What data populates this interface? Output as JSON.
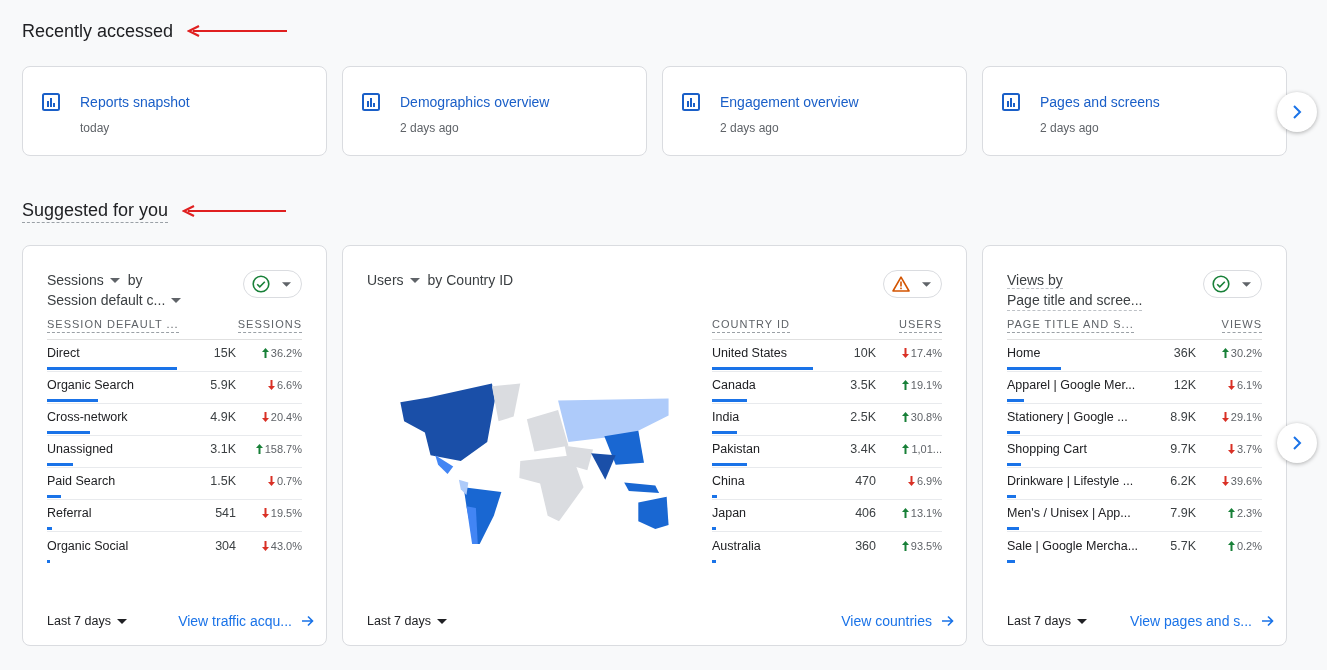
{
  "recently_accessed": {
    "heading": "Recently accessed",
    "items": [
      {
        "title": "Reports snapshot",
        "time": "today"
      },
      {
        "title": "Demographics overview",
        "time": "2 days ago"
      },
      {
        "title": "Engagement overview",
        "time": "2 days ago"
      },
      {
        "title": "Pages and screens",
        "time": "2 days ago"
      }
    ]
  },
  "suggested": {
    "heading": "Suggested for you",
    "cards": [
      {
        "kind": "table",
        "title": {
          "metric": "Sessions",
          "by": "by",
          "dimension": "Session default c...",
          "dropdown": true
        },
        "warning": false,
        "columns": [
          "SESSION DEFAULT ...",
          "SESSIONS"
        ],
        "rows": [
          {
            "name": "Direct",
            "value": "15K",
            "change": "36.2%",
            "rising": true,
            "level": 0.51
          },
          {
            "name": "Organic Search",
            "value": "5.9K",
            "change": "6.6%",
            "rising": false,
            "level": 0.2
          },
          {
            "name": "Cross-network",
            "value": "4.9K",
            "change": "20.4%",
            "rising": false,
            "level": 0.17
          },
          {
            "name": "Unassigned",
            "value": "3.1K",
            "change": "158.7%",
            "rising": true,
            "level": 0.1
          },
          {
            "name": "Paid Search",
            "value": "1.5K",
            "change": "0.7%",
            "rising": false,
            "level": 0.055
          },
          {
            "name": "Referral",
            "value": "541",
            "change": "19.5%",
            "rising": false,
            "level": 0.02
          },
          {
            "name": "Organic Social",
            "value": "304",
            "change": "43.0%",
            "rising": false,
            "level": 0.012
          }
        ],
        "range": "Last 7 days",
        "link": "View traffic acqu..."
      },
      {
        "kind": "map",
        "title": {
          "metric": "Users",
          "by": "by Country ID",
          "dropdown": true
        },
        "warning": true,
        "columns": [
          "COUNTRY ID",
          "USERS"
        ],
        "rows": [
          {
            "name": "United States",
            "value": "10K",
            "change": "17.4%",
            "rising": false,
            "level": 0.44
          },
          {
            "name": "Canada",
            "value": "3.5K",
            "change": "19.1%",
            "rising": true,
            "level": 0.15
          },
          {
            "name": "India",
            "value": "2.5K",
            "change": "30.8%",
            "rising": true,
            "level": 0.11
          },
          {
            "name": "Pakistan",
            "value": "3.4K",
            "change": "1,01...",
            "rising": true,
            "level": 0.15
          },
          {
            "name": "China",
            "value": "470",
            "change": "6.9%",
            "rising": false,
            "level": 0.02
          },
          {
            "name": "Japan",
            "value": "406",
            "change": "13.1%",
            "rising": true,
            "level": 0.017
          },
          {
            "name": "Australia",
            "value": "360",
            "change": "93.5%",
            "rising": true,
            "level": 0.017
          }
        ],
        "range": "Last 7 days",
        "link": "View countries"
      },
      {
        "kind": "table",
        "title": {
          "metric": "Views",
          "by": "by",
          "dimension": "Page title and scree...",
          "dropdown": false
        },
        "warning": false,
        "columns": [
          "PAGE TITLE AND S...",
          "VIEWS"
        ],
        "rows": [
          {
            "name": "Home",
            "value": "36K",
            "change": "30.2%",
            "rising": true,
            "level": 0.21
          },
          {
            "name": "Apparel | Google Mer...",
            "value": "12K",
            "change": "6.1%",
            "rising": false,
            "level": 0.066
          },
          {
            "name": "Stationery | Google ...",
            "value": "8.9K",
            "change": "29.1%",
            "rising": false,
            "level": 0.05
          },
          {
            "name": "Shopping Cart",
            "value": "9.7K",
            "change": "3.7%",
            "rising": false,
            "level": 0.055
          },
          {
            "name": "Drinkware | Lifestyle ...",
            "value": "6.2K",
            "change": "39.6%",
            "rising": false,
            "level": 0.035
          },
          {
            "name": "Men's / Unisex | App...",
            "value": "7.9K",
            "change": "2.3%",
            "rising": true,
            "level": 0.047
          },
          {
            "name": "Sale | Google Mercha...",
            "value": "5.7K",
            "change": "0.2%",
            "rising": true,
            "level": 0.03
          }
        ],
        "range": "Last 7 days",
        "link": "View pages and s..."
      }
    ]
  }
}
